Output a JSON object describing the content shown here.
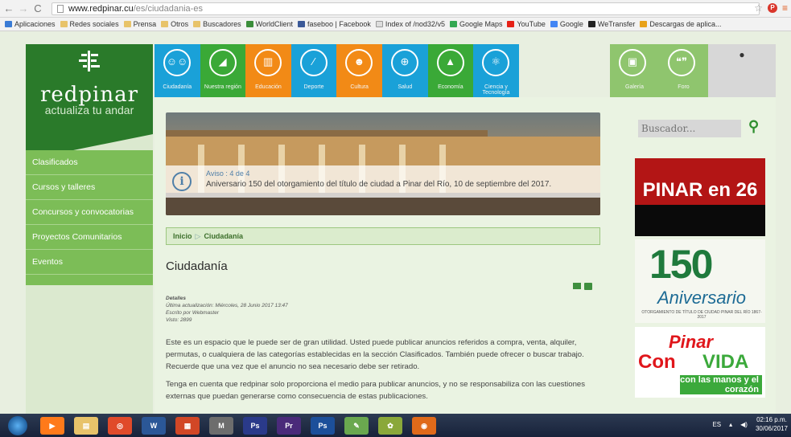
{
  "browser": {
    "url_host": "www.redpinar.cu",
    "url_path": "/es/ciudadania-es",
    "bookmarks": [
      "Aplicaciones",
      "Redes sociales",
      "Prensa",
      "Otros",
      "Buscadores",
      "WorldClient",
      "faseboo | Facebook",
      "Index of /nod32/v5",
      "Google Maps",
      "YouTube",
      "Google",
      "WeTransfer",
      "Descargas de aplica..."
    ]
  },
  "site": {
    "logo": {
      "name": "redpinar",
      "tagline": "actualiza tu andar"
    },
    "side_menu": [
      "Clasificados",
      "Cursos y talleres",
      "Concursos y convocatorias",
      "Proyectos Comunitarios",
      "Eventos"
    ],
    "nav": [
      {
        "label": "Ciudadanía",
        "color": "#1aa1d8",
        "icon": "people-icon"
      },
      {
        "label": "Nuestra región",
        "color": "#3aa937",
        "icon": "region-icon"
      },
      {
        "label": "Educación",
        "color": "#f28a16",
        "icon": "book-icon"
      },
      {
        "label": "Deporte",
        "color": "#1aa1d8",
        "icon": "sport-icon"
      },
      {
        "label": "Cultura",
        "color": "#f28a16",
        "icon": "theater-icon"
      },
      {
        "label": "Salud",
        "color": "#1aa1d8",
        "icon": "health-icon"
      },
      {
        "label": "Economía",
        "color": "#3aa937",
        "icon": "economy-icon"
      },
      {
        "label": "Ciencia y Tecnología",
        "color": "#1aa1d8",
        "icon": "science-icon"
      }
    ],
    "nav_right": [
      {
        "label": "Galería",
        "icon": "gallery-icon"
      },
      {
        "label": "Foro",
        "icon": "forum-icon"
      }
    ],
    "slider": {
      "aviso": "Aviso : 4 de 4",
      "caption": "Aniversario 150 del otorgamiento del título de ciudad a Pinar del Río, 10 de septiembre del 2017."
    },
    "breadcrumb": {
      "home": "Inicio",
      "sep": "▷",
      "current": "Ciudadanía"
    },
    "page_title": "Ciudadanía",
    "details": {
      "label": "Detalles",
      "updated": "Última actualización: Miércoles, 28 Junio 2017 13:47",
      "author": "Escrito por Webmaster",
      "views": "Visto: 2899"
    },
    "paragraph1": "Este es un espacio que le puede ser de gran utilidad. Usted puede publicar anuncios referidos a compra, venta, alquiler, permutas, o cualquiera de las categorías establecidas en la sección Clasificados. También puede ofrecer o buscar trabajo. Recuerde que una vez que el anuncio no sea necesario debe ser retirado.",
    "paragraph2": "Tenga en cuenta que redpinar solo proporciona el medio para publicar anuncios, y no se responsabiliza con las cuestiones externas que puedan generarse como consecuencia de estas publicaciones.",
    "search": {
      "placeholder": "Buscador..."
    },
    "banners": {
      "b1": "PINAR en 26",
      "b2_num": "150",
      "b2_text": "Aniversario",
      "b2_small": "OTORGAMIENTO DE TÍTULO DE CIUDAD PINAR DEL RÍO 1867-2017",
      "b3_pinar": "Pinar",
      "b3_con": "Con",
      "b3_vida": "VIDA",
      "b3_manos": "con las manos y el corazón"
    }
  },
  "taskbar": {
    "apps": [
      {
        "label": "▶",
        "color": "#ff7a1a"
      },
      {
        "label": "▤",
        "color": "#e8c36a"
      },
      {
        "label": "◎",
        "color": "#e04a2a"
      },
      {
        "label": "W",
        "color": "#2b5797"
      },
      {
        "label": "▦",
        "color": "#d24726"
      },
      {
        "label": "M",
        "color": "#6d6d6d"
      },
      {
        "label": "Ps",
        "color": "#2a3a8a"
      },
      {
        "label": "Pr",
        "color": "#4a2a7a"
      },
      {
        "label": "Ps",
        "color": "#1c4f9a"
      },
      {
        "label": "✎",
        "color": "#6aa84f"
      },
      {
        "label": "✿",
        "color": "#8aa83a"
      },
      {
        "label": "◉",
        "color": "#e06a1a"
      }
    ],
    "lang": "ES",
    "time": "02:16 p.m.",
    "date": "30/06/2017"
  }
}
